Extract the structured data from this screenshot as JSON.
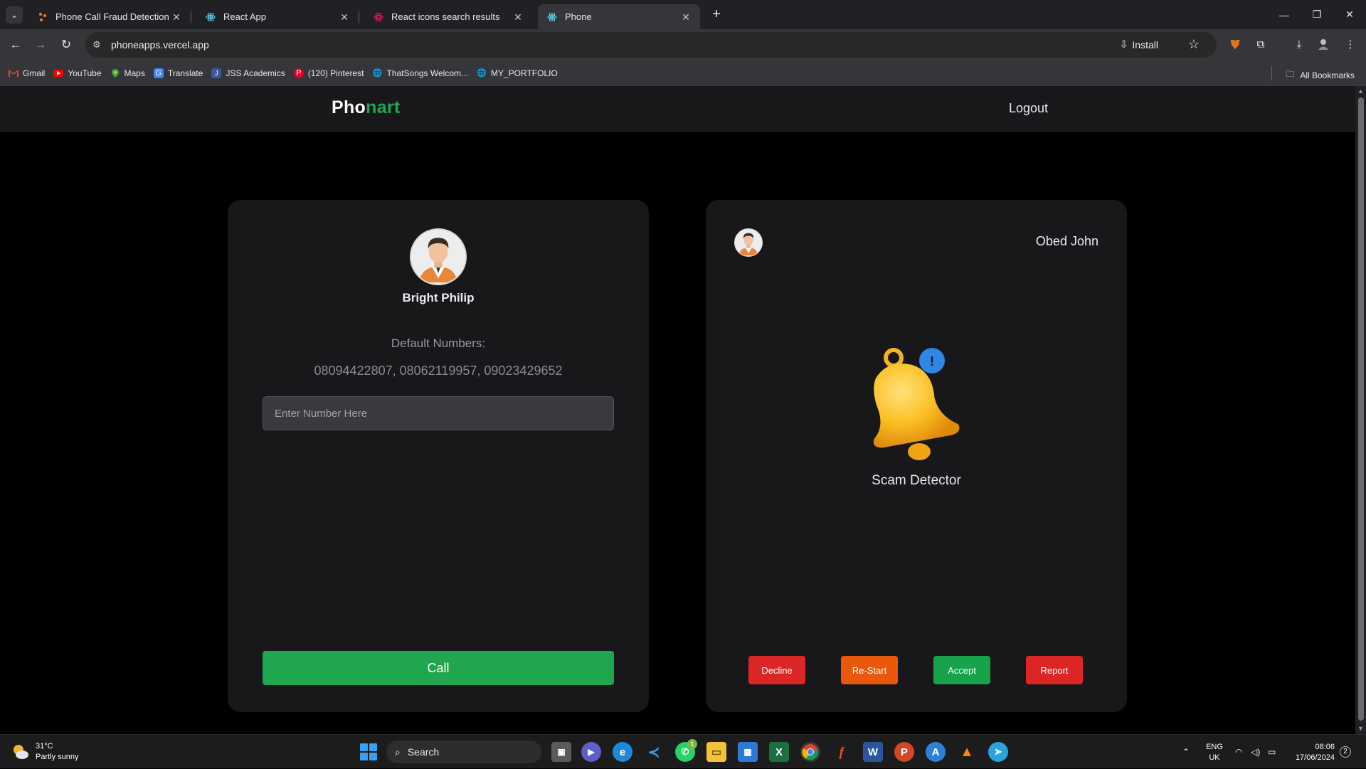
{
  "browser": {
    "tabs": [
      {
        "title": "Phone Call Fraud Detection | Ph",
        "icon": "fraud-favicon"
      },
      {
        "title": "React App",
        "icon": "react-favicon"
      },
      {
        "title": "React icons search results",
        "icon": "react-icons-favicon"
      },
      {
        "title": "Phone",
        "icon": "react-favicon",
        "active": true
      }
    ],
    "url": "phoneapps.vercel.app",
    "install_label": "Install",
    "bookmarks": [
      {
        "label": "Gmail",
        "icon": "gmail-icon"
      },
      {
        "label": "YouTube",
        "icon": "youtube-icon"
      },
      {
        "label": "Maps",
        "icon": "maps-icon"
      },
      {
        "label": "Translate",
        "icon": "translate-icon"
      },
      {
        "label": "JSS Academics",
        "icon": "jss-icon"
      },
      {
        "label": "(120) Pinterest",
        "icon": "pinterest-icon"
      },
      {
        "label": "ThatSongs Welcom...",
        "icon": "globe-icon"
      },
      {
        "label": "MY_PORTFOLIO",
        "icon": "globe-icon"
      }
    ],
    "all_bookmarks": "All Bookmarks"
  },
  "app": {
    "brand_part1": "Pho",
    "brand_part2": "nart",
    "brand_color": "#1fa64f",
    "logout": "Logout"
  },
  "caller": {
    "name": "Bright Philip",
    "default_label": "Default Numbers:",
    "default_numbers": "08094422807, 08062119957, 09023429652",
    "input_placeholder": "Enter Number Here",
    "input_value": "",
    "call_label": "Call"
  },
  "receiver": {
    "name": "Obed John",
    "status_label": "Scam Detector",
    "actions": {
      "decline": "Decline",
      "restart": "Re-Start",
      "accept": "Accept",
      "report": "Report"
    },
    "colors": {
      "decline": "#dc2626",
      "restart": "#ea580c",
      "accept": "#16a34a",
      "report": "#dc2626"
    }
  },
  "taskbar": {
    "temp": "31°C",
    "weather": "Partly sunny",
    "search": "Search",
    "lang_1": "ENG",
    "lang_2": "UK",
    "time": "08:06",
    "date": "17/06/2024",
    "notifications": "2",
    "whatsapp_badge": "1"
  }
}
